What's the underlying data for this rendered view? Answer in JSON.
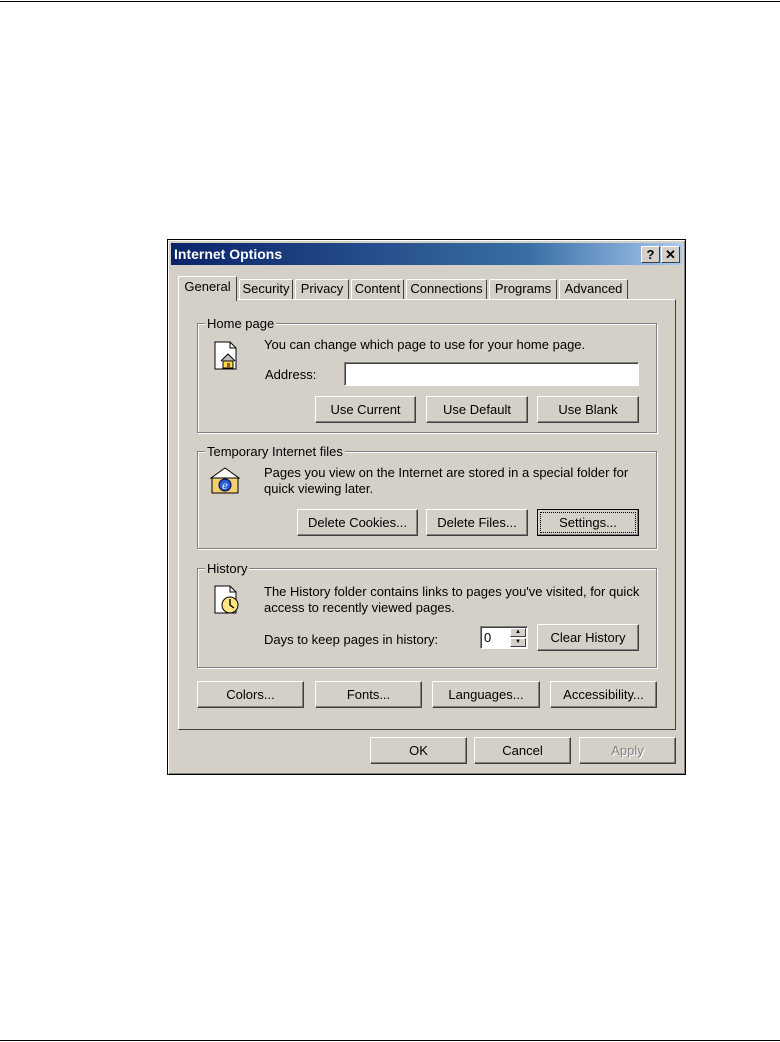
{
  "window": {
    "title": "Internet Options",
    "help": "?",
    "close": "✕"
  },
  "tabs": [
    "General",
    "Security",
    "Privacy",
    "Content",
    "Connections",
    "Programs",
    "Advanced"
  ],
  "home": {
    "label": "Home page",
    "desc": "You can change which page to use for your home page.",
    "address_label": "Address:",
    "address_value": "",
    "use_current": "Use Current",
    "use_default": "Use Default",
    "use_blank": "Use Blank"
  },
  "temp": {
    "label": "Temporary Internet files",
    "desc": "Pages you view on the Internet are stored in a special folder for quick viewing later.",
    "delete_cookies": "Delete Cookies...",
    "delete_files": "Delete Files...",
    "settings": "Settings..."
  },
  "history": {
    "label": "History",
    "desc": "The History folder contains links to pages you've visited, for quick access to recently viewed pages.",
    "days_label": "Days to keep pages in history:",
    "days_value": "0",
    "clear": "Clear History"
  },
  "bottom_buttons": {
    "colors": "Colors...",
    "fonts": "Fonts...",
    "languages": "Languages...",
    "accessibility": "Accessibility..."
  },
  "dialog_buttons": {
    "ok": "OK",
    "cancel": "Cancel",
    "apply": "Apply"
  },
  "icons": {
    "home": "home-page-icon",
    "temp": "ie-folder-icon",
    "history": "history-icon"
  }
}
